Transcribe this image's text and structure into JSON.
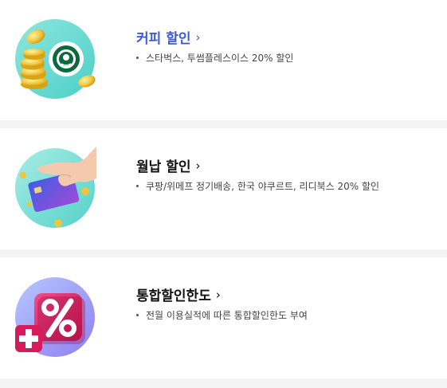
{
  "items": [
    {
      "title": "커피 할인",
      "description": "스타벅스, 투썸플레스이스 20% 할인",
      "image": "starbucks-coins-icon",
      "accent": "#3d5bd8"
    },
    {
      "title": "월납 할인",
      "description": "쿠팡/위메프 정기배송, 한국 야쿠르트, 리디북스 20% 할인",
      "image": "hand-card-icon"
    },
    {
      "title": "통합할인한도",
      "description": "전월 이용실적에 따른 통합할인한도 부여",
      "image": "percent-plus-icon"
    }
  ],
  "chevron": "›"
}
